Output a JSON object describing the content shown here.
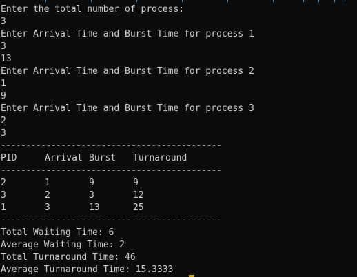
{
  "terminal": {
    "accent": "#3a96dd",
    "background": "#0c0c0c",
    "foreground": "#cccccc",
    "cursor_color": "#c9a227"
  },
  "input": {
    "prompt_total": "Enter the total number of process:",
    "total_value": "3",
    "prompt_p1": "Enter Arrival Time and Burst Time for process 1",
    "p1_arrival": "3",
    "p1_burst": "13",
    "prompt_p2": "Enter Arrival Time and Burst Time for process 2",
    "p2_arrival": "1",
    "p2_burst": "9",
    "prompt_p3": "Enter Arrival Time and Burst Time for process 3",
    "p3_arrival": "2",
    "p3_burst": "3"
  },
  "separator": "--------------------------------------------",
  "table": {
    "headers": [
      "PID",
      "Arrival",
      "Burst",
      "Turnaround"
    ],
    "rows": [
      [
        "2",
        "1",
        "9",
        "9"
      ],
      [
        "3",
        "2",
        "3",
        "12"
      ],
      [
        "1",
        "3",
        "13",
        "25"
      ]
    ]
  },
  "summary": {
    "total_waiting": "Total Waiting Time: 6",
    "avg_waiting": "Average Waiting Time: 2",
    "total_turnaround": "Total Turnaround Time: 46",
    "avg_turnaround": "Average Turnaround Time: 15.3333"
  }
}
